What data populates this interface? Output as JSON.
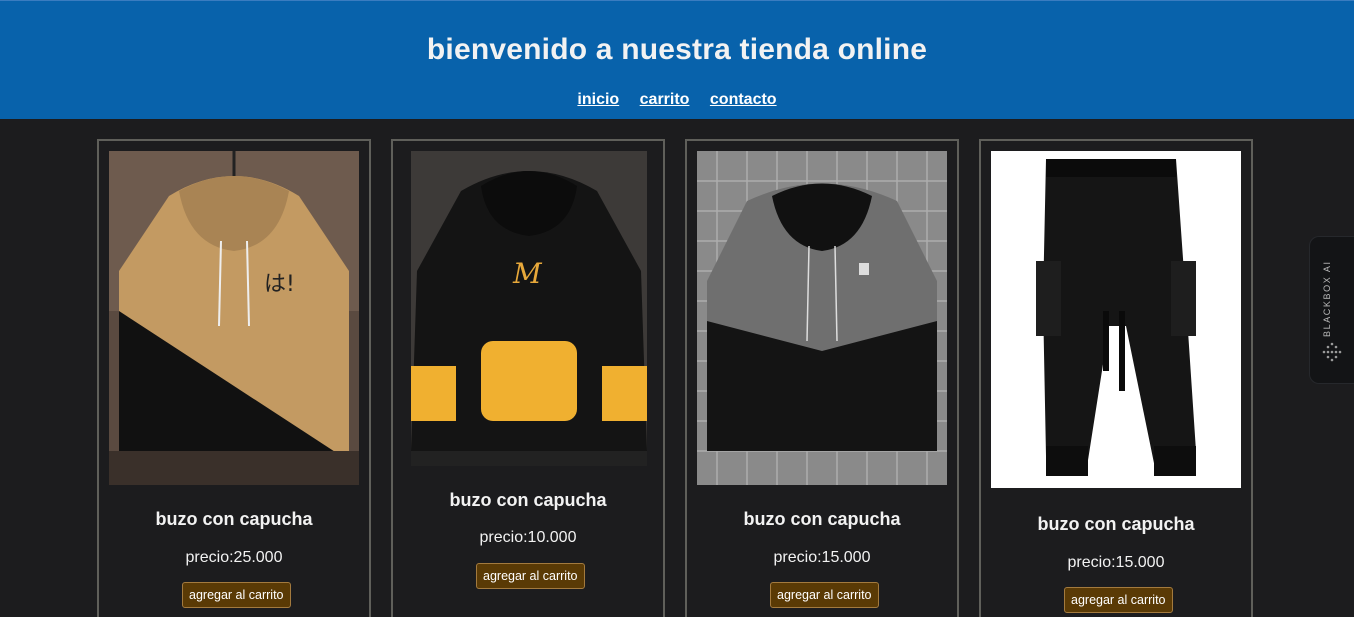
{
  "header": {
    "title": "bienvenido a nuestra tienda online",
    "nav": [
      "inicio",
      "carrito",
      "contacto"
    ]
  },
  "products": [
    {
      "name": "buzo con capucha",
      "price": "precio:25.000",
      "button": "agregar al carrito",
      "image": "tan-black-hoodie-image"
    },
    {
      "name": "buzo con capucha",
      "price": "precio:10.000",
      "button": "agregar al carrito",
      "image": "black-yellow-hoodie-image"
    },
    {
      "name": "buzo con capucha",
      "price": "precio:15.000",
      "button": "agregar al carrito",
      "image": "grey-black-hoodie-image"
    },
    {
      "name": "buzo con capucha",
      "price": "precio:15.000",
      "button": "agregar al carrito",
      "image": "black-cargo-pants-image"
    }
  ],
  "side_widget": {
    "label": "BLACKBOX AI",
    "icon": "blackbox-logo-icon"
  },
  "colors": {
    "header_bg": "#0862ab",
    "page_bg": "#1c1c1e",
    "button_bg": "#5a3a05",
    "card_border": "#5f5f5a"
  }
}
